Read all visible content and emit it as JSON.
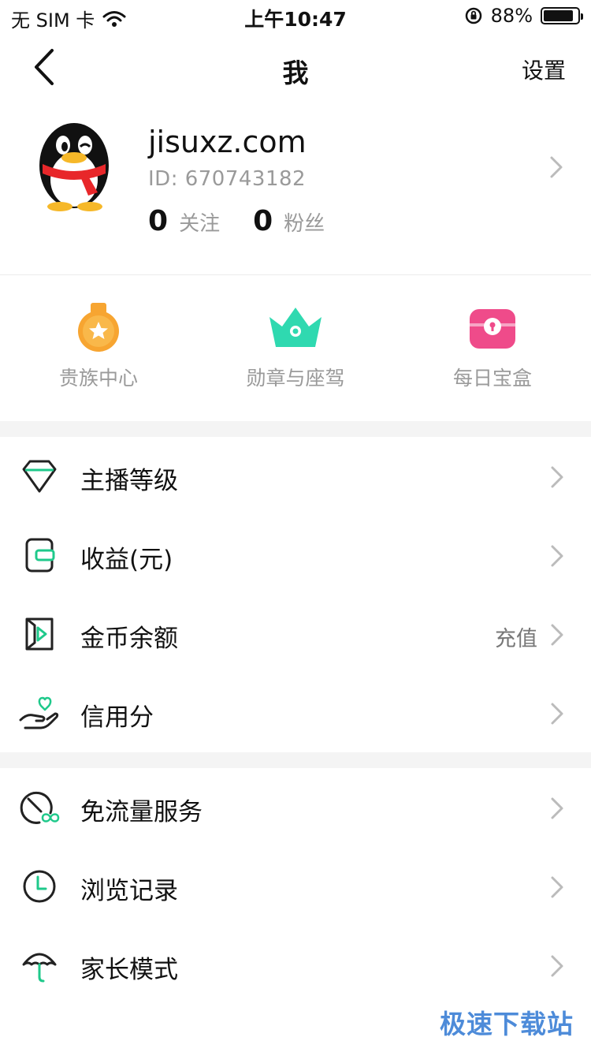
{
  "status_bar": {
    "carrier": "无 SIM 卡",
    "time": "上午10:47",
    "battery_text": "88%",
    "battery_level": 0.88
  },
  "nav": {
    "title": "我",
    "settings": "设置"
  },
  "profile": {
    "username": "jisuxz.com",
    "id_text": "ID: 670743182",
    "following_count": "0",
    "following_label": "关注",
    "fans_count": "0",
    "fans_label": "粉丝"
  },
  "quick_actions": [
    {
      "label": "贵族中心",
      "icon": "medal-icon"
    },
    {
      "label": "勋章与座驾",
      "icon": "crown-icon"
    },
    {
      "label": "每日宝盒",
      "icon": "treasure-box-icon"
    }
  ],
  "menu_group_1": [
    {
      "label": "主播等级",
      "icon": "diamond-icon",
      "extra": ""
    },
    {
      "label": "收益(元)",
      "icon": "wallet-icon",
      "extra": ""
    },
    {
      "label": "金币余额",
      "icon": "coin-balance-icon",
      "extra": "充值"
    },
    {
      "label": "信用分",
      "icon": "hand-heart-icon",
      "extra": ""
    }
  ],
  "menu_group_2": [
    {
      "label": "免流量服务",
      "icon": "data-free-icon"
    },
    {
      "label": "浏览记录",
      "icon": "clock-icon"
    },
    {
      "label": "家长模式",
      "icon": "umbrella-icon"
    }
  ],
  "watermark": "极速下载站",
  "colors": {
    "accent_green": "#1fc98b",
    "medal_orange": "#f7a531",
    "crown_teal": "#2fd9b0",
    "box_pink": "#ef4b8a",
    "gap_gray": "#f4f4f4"
  }
}
